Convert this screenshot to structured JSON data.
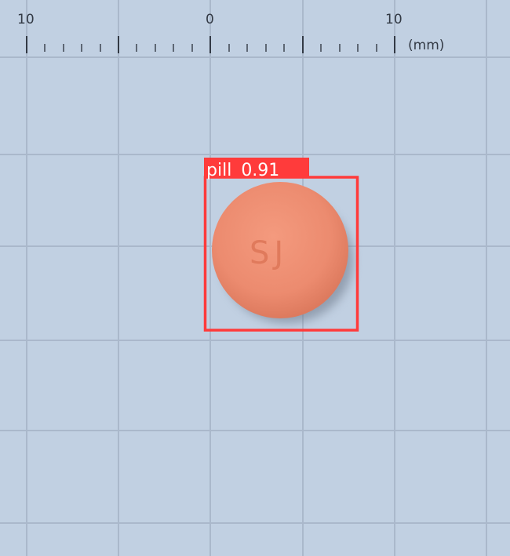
{
  "ruler": {
    "labels": [
      "10",
      "0",
      "10"
    ],
    "unit": "(mm)"
  },
  "detection": {
    "label": "pill",
    "score": "0.91",
    "box_color": "#ff3b3b"
  },
  "pill": {
    "imprint": "SJ",
    "color": "#ec8e71"
  },
  "background": {
    "color": "#c1d0e2",
    "grid_color": "#aab8cb"
  }
}
